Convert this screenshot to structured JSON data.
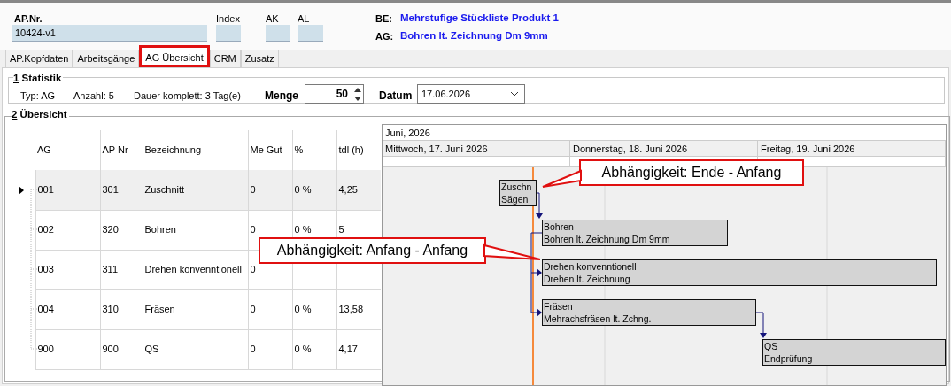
{
  "header": {
    "ap_nr": {
      "label": "AP.Nr.",
      "value": "10424-v1"
    },
    "index": {
      "label": "Index"
    },
    "ak": {
      "label": "AK"
    },
    "al": {
      "label": "AL"
    },
    "be": {
      "label": "BE:",
      "value": "Mehrstufige Stückliste Produkt 1"
    },
    "ag": {
      "label": "AG:",
      "value": "Bohren lt. Zeichnung Dm 9mm"
    }
  },
  "tabs": [
    {
      "label": "AP.Kopfdaten",
      "selected": false
    },
    {
      "label": "Arbeitsgänge",
      "selected": false
    },
    {
      "label": "AG Übersicht",
      "selected": true
    },
    {
      "label": "CRM",
      "selected": false
    },
    {
      "label": "Zusatz",
      "selected": false
    }
  ],
  "statistik": {
    "mnemonic": "1",
    "title": "Statistik",
    "typ": "Typ: AG",
    "anzahl": "Anzahl: 5",
    "dauer": "Dauer komplett: 3 Tag(e)",
    "menge": {
      "label": "Menge",
      "value": "50"
    },
    "datum": {
      "label": "Datum",
      "value": "17.06.2026"
    }
  },
  "uebersicht": {
    "mnemonic": "2",
    "title": "Übersicht",
    "grid": {
      "columns": [
        "AG",
        "AP Nr",
        "Bezeichnung",
        "Me Gut",
        "%",
        "tdl (h)"
      ],
      "rows": [
        {
          "selected": true,
          "cells": [
            "001",
            "301",
            "Zuschnitt",
            "0",
            "0 %",
            "4,25"
          ]
        },
        {
          "selected": false,
          "cells": [
            "002",
            "320",
            "Bohren",
            "0",
            "0 %",
            "5"
          ]
        },
        {
          "selected": false,
          "cells": [
            "003",
            "311",
            "Drehen konvenntionell",
            "0"
          ]
        },
        {
          "selected": false,
          "cells": [
            "004",
            "310",
            "Fräsen",
            "0",
            "0 %",
            "13,58"
          ]
        },
        {
          "selected": false,
          "cells": [
            "900",
            "900",
            "QS",
            "0",
            "0 %",
            "4,17"
          ]
        }
      ]
    },
    "gantt": {
      "month": "Juni, 2026",
      "days": [
        "Mittwoch, 17. Juni 2026",
        "Donnerstag, 18. Juni 2026",
        "Freitag, 19. Juni 2026"
      ],
      "bars": [
        {
          "title": "Zuschn",
          "subtitle": "Sägen"
        },
        {
          "title": "Bohren",
          "subtitle": "Bohren lt. Zeichnung Dm 9mm"
        },
        {
          "title": "Drehen konvenntionell",
          "subtitle": "Drehen lt. Zeichnung"
        },
        {
          "title": "Fräsen",
          "subtitle": "Mehrachsfräsen lt. Zchng."
        },
        {
          "title": "QS",
          "subtitle": "Endprüfung"
        }
      ]
    }
  },
  "callouts": [
    "Abhängigkeit: Ende - Anfang",
    "Abhängigkeit: Anfang - Anfang"
  ]
}
